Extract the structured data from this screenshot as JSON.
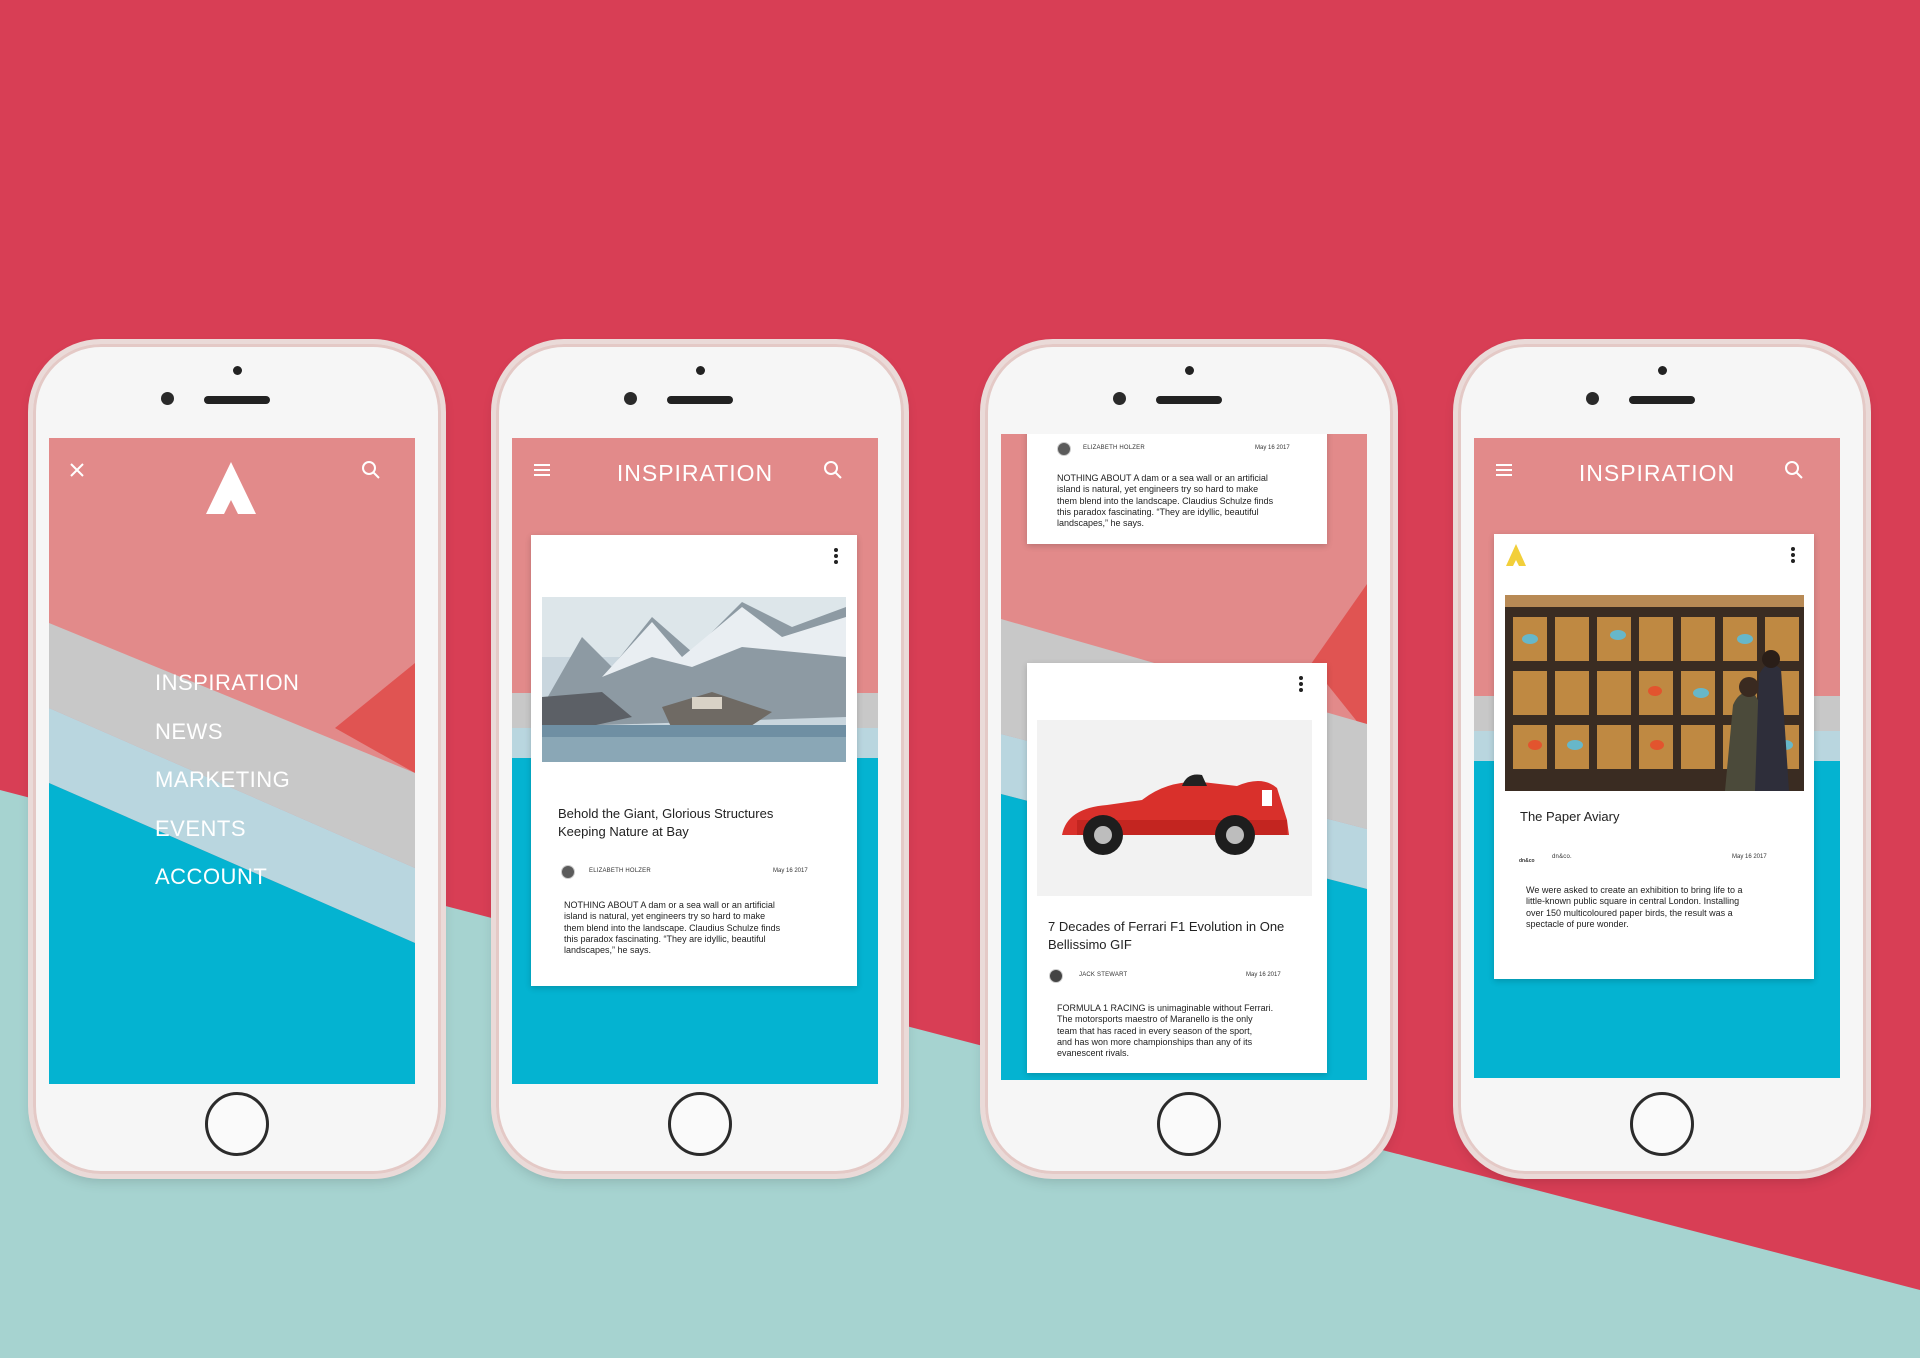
{
  "colors": {
    "background_red": "#d83e55",
    "background_mint": "#a6d3d0",
    "screen_pink": "#e28a8a",
    "screen_coral": "#e05452",
    "screen_grey": "#c8c8c8",
    "screen_lightblue": "#b9d6df",
    "screen_cyan": "#04b3d1",
    "logo_yellow": "#f2cf3a"
  },
  "phone1": {
    "icons": {
      "close": "close-icon",
      "search": "search-icon",
      "logo": "logo-triangle-icon"
    },
    "menu": [
      "INSPIRATION",
      "NEWS",
      "MARKETING",
      "EVENTS",
      "ACCOUNT"
    ]
  },
  "phone2": {
    "title": "INSPIRATION",
    "icons": {
      "menu": "hamburger-icon",
      "search": "search-icon",
      "more": "more-vert-icon"
    },
    "card": {
      "title_line1": "Behold the Giant, Glorious Structures",
      "title_line2": "Keeping Nature at Bay",
      "author": "ELIZABETH HOLZER",
      "date": "May 16 2017",
      "body": [
        "NOTHING ABOUT A dam or a sea wall or an artificial",
        "island is natural, yet engineers try so hard to make",
        "them blend into the landscape. Claudius Schulze finds",
        "this paradox fascinating. “They are idyllic, beautiful",
        "landscapes,” he says."
      ]
    }
  },
  "phone3": {
    "card_top": {
      "author": "ELIZABETH HOLZER",
      "date": "May 16 2017",
      "body": [
        "NOTHING ABOUT A dam or a sea wall or an artificial",
        "island is natural, yet engineers try so hard to make",
        "them blend into the landscape. Claudius Schulze finds",
        "this paradox fascinating. “They are idyllic, beautiful",
        "landscapes,” he says."
      ]
    },
    "card": {
      "title_line1": "7 Decades of Ferrari F1 Evolution in One",
      "title_line2": "Bellissimo GIF",
      "author": "JACK STEWART",
      "date": "May 16 2017",
      "body": [
        "FORMULA 1 RACING is unimaginable without Ferrari.",
        "The motorsports maestro of Maranello is the only",
        "team that has raced in every season of the sport,",
        "and has won more championships than any of its",
        "evanescent rivals."
      ]
    }
  },
  "phone4": {
    "title": "INSPIRATION",
    "card": {
      "title": "The Paper Aviary",
      "author_logo": "dn&co",
      "author": "dn&co.",
      "date": "May 16 2017",
      "body": [
        "We were asked to create an exhibition to bring life to a",
        "little-known public square in central London. Installing",
        "over 150 multicoloured paper birds, the result was a",
        "spectacle of pure wonder."
      ]
    }
  }
}
